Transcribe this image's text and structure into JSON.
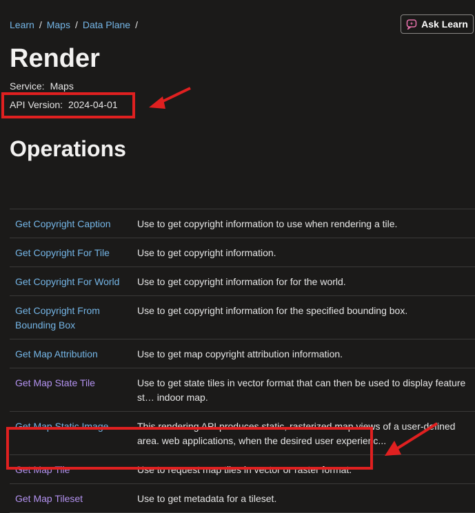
{
  "breadcrumb": [
    {
      "label": "Learn"
    },
    {
      "label": "Maps"
    },
    {
      "label": "Data Plane"
    }
  ],
  "ask_button": {
    "label": "Ask Learn",
    "icon": "sparkle-chat-icon"
  },
  "page": {
    "title": "Render",
    "service_label": "Service:",
    "service_value": "Maps",
    "api_version_label": "API Version:",
    "api_version_value": "2024-04-01",
    "section_heading": "Operations"
  },
  "operations": [
    {
      "name": "Get Copyright Caption",
      "description": "Use to get copyright information to use when rendering a tile."
    },
    {
      "name": "Get Copyright For Tile",
      "description": "Use to get copyright information."
    },
    {
      "name": "Get Copyright For World",
      "description": "Use to get copyright information for for the world."
    },
    {
      "name": "Get Copyright From Bounding Box",
      "description": "Use to get copyright information for the specified bounding box."
    },
    {
      "name": "Get Map Attribution",
      "description": "Use to get map copyright attribution information."
    },
    {
      "name": "Get Map State Tile",
      "description": "Use to get state tiles in vector format that can then be used to display feature st… indoor map."
    },
    {
      "name": "Get Map Static Image",
      "description": "This rendering API produces static, rasterized map views of a user-defined area. web applications, when the desired user experienc..."
    },
    {
      "name": "Get Map Tile",
      "description": "Use to request map tiles in vector or raster format."
    },
    {
      "name": "Get Map Tileset",
      "description": "Use to get metadata for a tileset."
    }
  ],
  "colors": {
    "background": "#1b1a19",
    "link": "#75b6e7",
    "visited_link": "#b392f0",
    "annotation_red": "#e02020"
  }
}
